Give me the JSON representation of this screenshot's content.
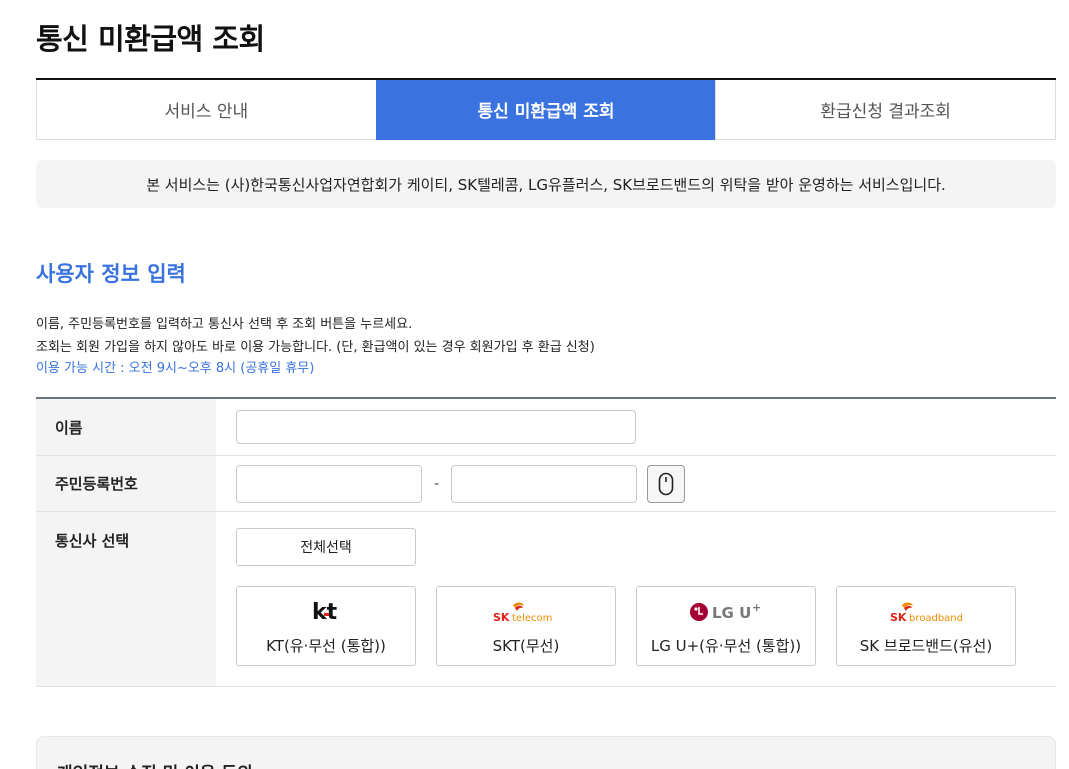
{
  "page": {
    "title": "통신 미환급액 조회"
  },
  "tabs": [
    {
      "label": "서비스 안내",
      "active": false
    },
    {
      "label": "통신 미환급액 조회",
      "active": true
    },
    {
      "label": "환급신청 결과조회",
      "active": false
    }
  ],
  "notice": {
    "text": "본 서비스는 (사)한국통신사업자연합회가 케이티, SK텔레콤, LG유플러스, SK브로드밴드의 위탁을 받아 운영하는 서비스입니다."
  },
  "section": {
    "title": "사용자 정보 입력",
    "desc_line1": "이름, 주민등록번호를 입력하고 통신사 선택 후 조회 버튼을 누르세요.",
    "desc_line2": "조회는 회원 가입을 하지 않아도 바로 이용 가능합니다. (단, 환급액이 있는 경우 회원가입 후 환급 신청)",
    "hours": "이용 가능 시간 : 오전 9시~오후 8시 (공휴일 휴무)"
  },
  "form": {
    "name_label": "이름",
    "name_value": "",
    "id_label": "주민등록번호",
    "id_front_value": "",
    "id_back_value": "",
    "id_separator": "-",
    "mouse_icon": "mouse-icon",
    "carrier_label": "통신사 선택",
    "select_all_label": "전체선택"
  },
  "carriers": [
    {
      "name": "KT(유·무선 (통합))",
      "logo_text": "kt",
      "logo_icon": "kt-logo"
    },
    {
      "name": "SKT(무선)",
      "logo_text": "SK telecom",
      "logo_icon": "sk-telecom-logo"
    },
    {
      "name": "LG U+(유·무선 (통합))",
      "logo_text": "LG U+",
      "logo_icon": "lg-uplus-logo"
    },
    {
      "name": "SK 브로드밴드(유선)",
      "logo_text": "SK broadband",
      "logo_icon": "sk-broadband-logo"
    }
  ],
  "privacy": {
    "title": "개인정보 수집 및 이용 동의"
  },
  "colors": {
    "accent": "#3a73df",
    "sk_red": "#e2231a",
    "sk_orange": "#f08c00",
    "lg_magenta": "#a50034"
  }
}
